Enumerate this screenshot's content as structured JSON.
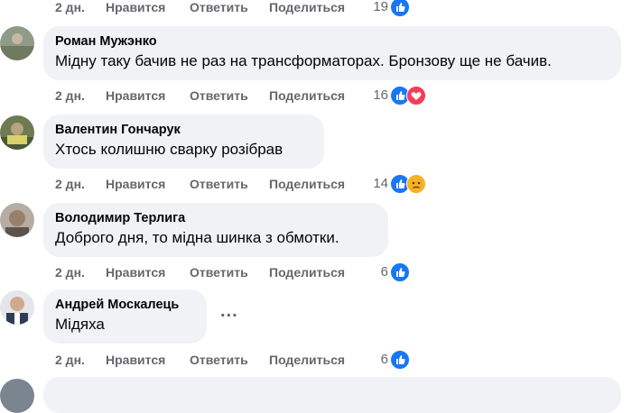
{
  "top_actions": {
    "time": "2 дн.",
    "like": "Нравится",
    "reply": "Ответить",
    "share": "Поделиться",
    "count": "19"
  },
  "comments": [
    {
      "author": "Роман Мужэнко",
      "text": "Мідну таку бачив не раз на трансформаторах. Бронзову ще не бачив.",
      "time": "2 дн.",
      "like": "Нравится",
      "reply": "Ответить",
      "share": "Поделиться",
      "count": "16",
      "reactions": [
        "like",
        "love"
      ]
    },
    {
      "author": "Валентин Гончарук",
      "text": "Хтось колишню сварку розібрав",
      "time": "2 дн.",
      "like": "Нравится",
      "reply": "Ответить",
      "share": "Поделиться",
      "count": "14",
      "reactions": [
        "like",
        "sad"
      ]
    },
    {
      "author": "Володимир Терлига",
      "text": "Доброго дня, то мідна шинка з обмотки.",
      "time": "2 дн.",
      "like": "Нравится",
      "reply": "Ответить",
      "share": "Поделиться",
      "count": "6",
      "reactions": [
        "like"
      ]
    },
    {
      "author": "Андрей Москалець",
      "text": "Мідяха",
      "time": "2 дн.",
      "like": "Нравится",
      "reply": "Ответить",
      "share": "Поделиться",
      "count": "6",
      "reactions": [
        "like"
      ]
    }
  ],
  "more_button": "...",
  "colors": {
    "like": "#1877f2",
    "love": "#f33e58",
    "sad": "#f7b125",
    "bubble": "#f0f2f5",
    "meta": "#65676b"
  }
}
